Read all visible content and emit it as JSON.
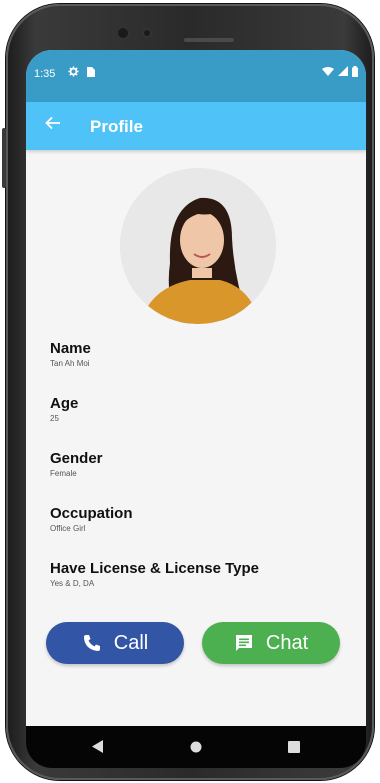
{
  "status_bar": {
    "time": "1:35",
    "left_icons": [
      "settings-icon",
      "sim-card-icon"
    ],
    "right_icons": [
      "wifi-icon",
      "signal-icon",
      "battery-icon"
    ]
  },
  "app_bar": {
    "title": "Profile",
    "back_icon": "arrow-left-icon"
  },
  "profile": {
    "fields": [
      {
        "label": "Name",
        "value": "Tan Ah Moi"
      },
      {
        "label": "Age",
        "value": "25"
      },
      {
        "label": "Gender",
        "value": "Female"
      },
      {
        "label": "Occupation",
        "value": "Office Girl"
      },
      {
        "label": "Have License & License Type",
        "value": "Yes & D, DA"
      }
    ]
  },
  "actions": {
    "call_label": "Call",
    "chat_label": "Chat"
  },
  "colors": {
    "status_bar": "#399cc6",
    "app_bar": "#4fc3f7",
    "call_button": "#3355a6",
    "chat_button": "#4caf50"
  },
  "nav_bar": {
    "icons": [
      "back-triangle-icon",
      "home-circle-icon",
      "recents-square-icon"
    ]
  }
}
